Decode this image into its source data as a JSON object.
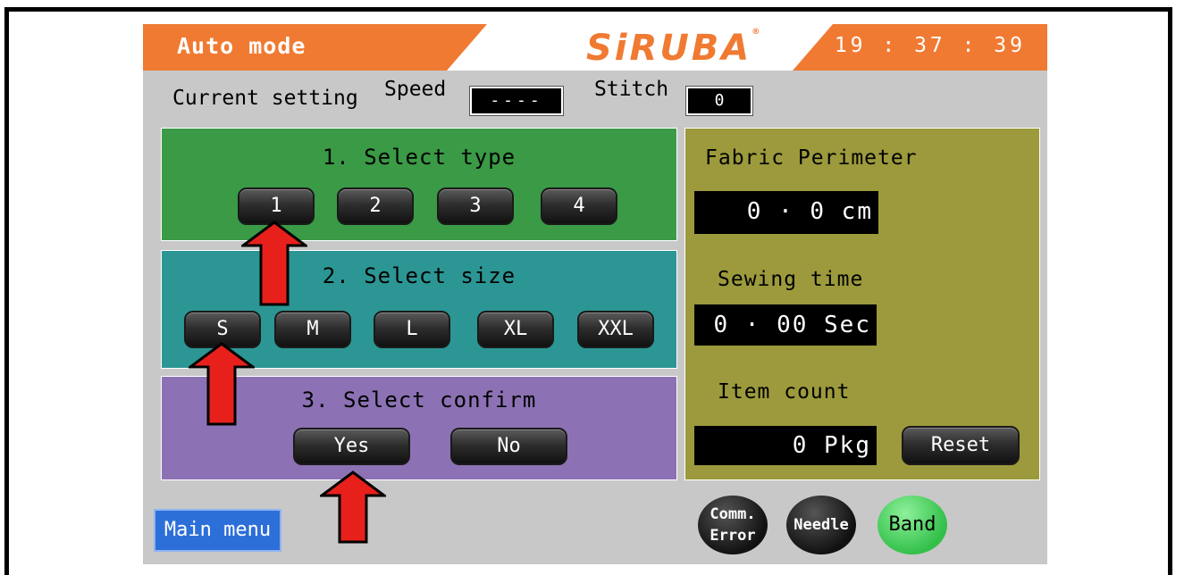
{
  "header": {
    "mode_title": "Auto mode",
    "logo_text": "SiRUBA",
    "logo_mark": "®",
    "clock": "19 : 37 : 39"
  },
  "current_setting": {
    "label": "Current setting",
    "speed_label": "Speed",
    "speed_value": "----",
    "stitch_label": "Stitch",
    "stitch_value": "0"
  },
  "select_type": {
    "title": "1. Select type",
    "buttons": [
      "1",
      "2",
      "3",
      "4"
    ]
  },
  "select_size": {
    "title": "2. Select size",
    "buttons": [
      "S",
      "M",
      "L",
      "XL",
      "XXL"
    ]
  },
  "select_confirm": {
    "title": "3. Select confirm",
    "yes": "Yes",
    "no": "No"
  },
  "info": {
    "fabric_perimeter_label": "Fabric Perimeter",
    "fabric_perimeter_value": "0 · 0 cm",
    "sewing_time_label": "Sewing time",
    "sewing_time_value": "0 · 00 Sec",
    "item_count_label": "Item count",
    "item_count_value": "0 Pkg",
    "reset_label": "Reset"
  },
  "footer": {
    "main_menu": "Main menu",
    "comm_error_line1": "Comm.",
    "comm_error_line2": "Error",
    "needle": "Needle",
    "band": "Band"
  },
  "colors": {
    "orange": "#f07a32",
    "type_panel": "#3a9a46",
    "size_panel": "#2c9694",
    "confirm_panel": "#8c72b4",
    "info_panel": "#9c9a3c",
    "arrow_red": "#e8201c",
    "band_green": "#33c04a"
  }
}
